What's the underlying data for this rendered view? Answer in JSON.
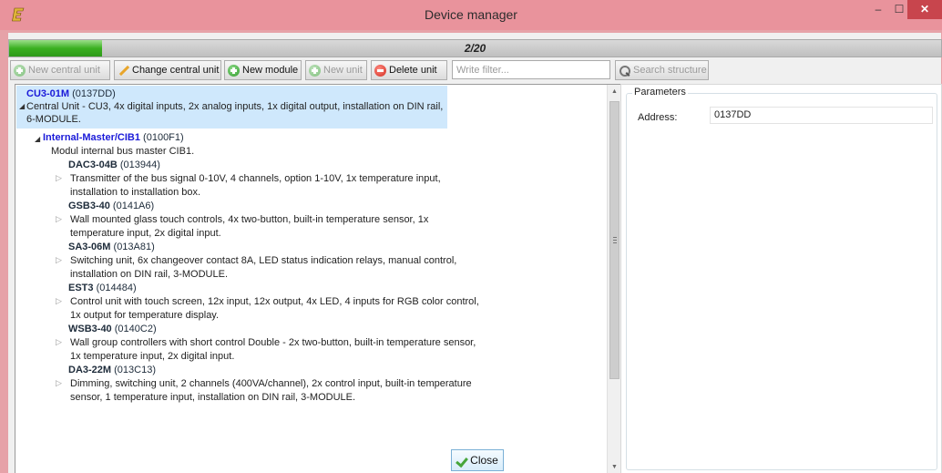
{
  "window": {
    "title": "Device manager",
    "minimize_glyph": "–",
    "maximize_glyph": "☐",
    "close_glyph": "✕",
    "accent_color": "#e9939c"
  },
  "progress": {
    "text": "2/20",
    "fraction": 0.1
  },
  "toolbar": {
    "new_central_unit": "New central unit",
    "change_central_unit": "Change central unit",
    "new_module": "New module",
    "new_unit": "New unit",
    "delete_unit": "Delete unit",
    "filter_placeholder": "Write filter...",
    "search_structure": "Search structure"
  },
  "tree": {
    "root": {
      "name": "CU3-01M",
      "code": "(0137DD)",
      "description_line1": "Central Unit - CU3, 4x digital inputs, 2x analog inputs, 1x digital output, installation on DIN rail,",
      "description_line2": "6-MODULE."
    },
    "master": {
      "name": "Internal-Master/CIB1",
      "code": "(0100F1)",
      "description": "Modul internal bus master CIB1."
    },
    "devices": [
      {
        "name": "DAC3-04B",
        "code": "(013944)",
        "line1": "Transmitter of the bus signal 0-10V, 4 channels, option 1-10V, 1x temperature input,",
        "line2": "installation to installation box."
      },
      {
        "name": "GSB3-40",
        "code": "(0141A6)",
        "line1": "Wall mounted glass touch controls, 4x two-button, built-in temperature sensor, 1x",
        "line2": "temperature input, 2x digital input."
      },
      {
        "name": "SA3-06M",
        "code": "(013A81)",
        "line1": "Switching unit, 6x changeover contact 8A, LED status indication relays, manual control,",
        "line2": "installation on DIN rail, 3-MODULE."
      },
      {
        "name": "EST3",
        "code": "(014484)",
        "line1": "Control unit with touch screen, 12x input, 12x output, 4x LED, 4 inputs for RGB color control,",
        "line2": "1x output for temperature display."
      },
      {
        "name": "WSB3-40",
        "code": "(0140C2)",
        "line1": "Wall group controllers with short control Double - 2x two-button, built-in temperature sensor,",
        "line2": "1x temperature input, 2x digital input."
      },
      {
        "name": "DA3-22M",
        "code": "(013C13)",
        "line1": "Dimming, switching unit, 2 channels (400VA/channel), 2x control input, built-in temperature",
        "line2": "sensor, 1 temperature input, installation on DIN rail, 3-MODULE."
      }
    ]
  },
  "parameters": {
    "title": "Parameters",
    "address_label": "Address:",
    "address_value": "0137DD"
  },
  "footer": {
    "close_label": "Close"
  }
}
